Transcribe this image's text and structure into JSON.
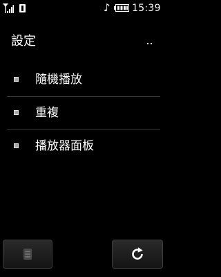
{
  "status_bar": {
    "time": "15:39",
    "icons": {
      "signal": "signal-strength-icon",
      "sim": "sim-card-icon",
      "music": "music-note-icon",
      "battery": "battery-icon"
    }
  },
  "header": {
    "title": "設定",
    "more_icon": "more-options-icon"
  },
  "menu": {
    "items": [
      {
        "label": "隨機播放"
      },
      {
        "label": "重複"
      },
      {
        "label": "播放器面板"
      }
    ]
  },
  "softkeys": {
    "left_icon": "list-menu-icon",
    "right_icon": "refresh-icon"
  },
  "colors": {
    "background": "#000000",
    "text": "#ffffff",
    "divider": "#3a3a3a",
    "bullet": "#a7a7a7"
  }
}
